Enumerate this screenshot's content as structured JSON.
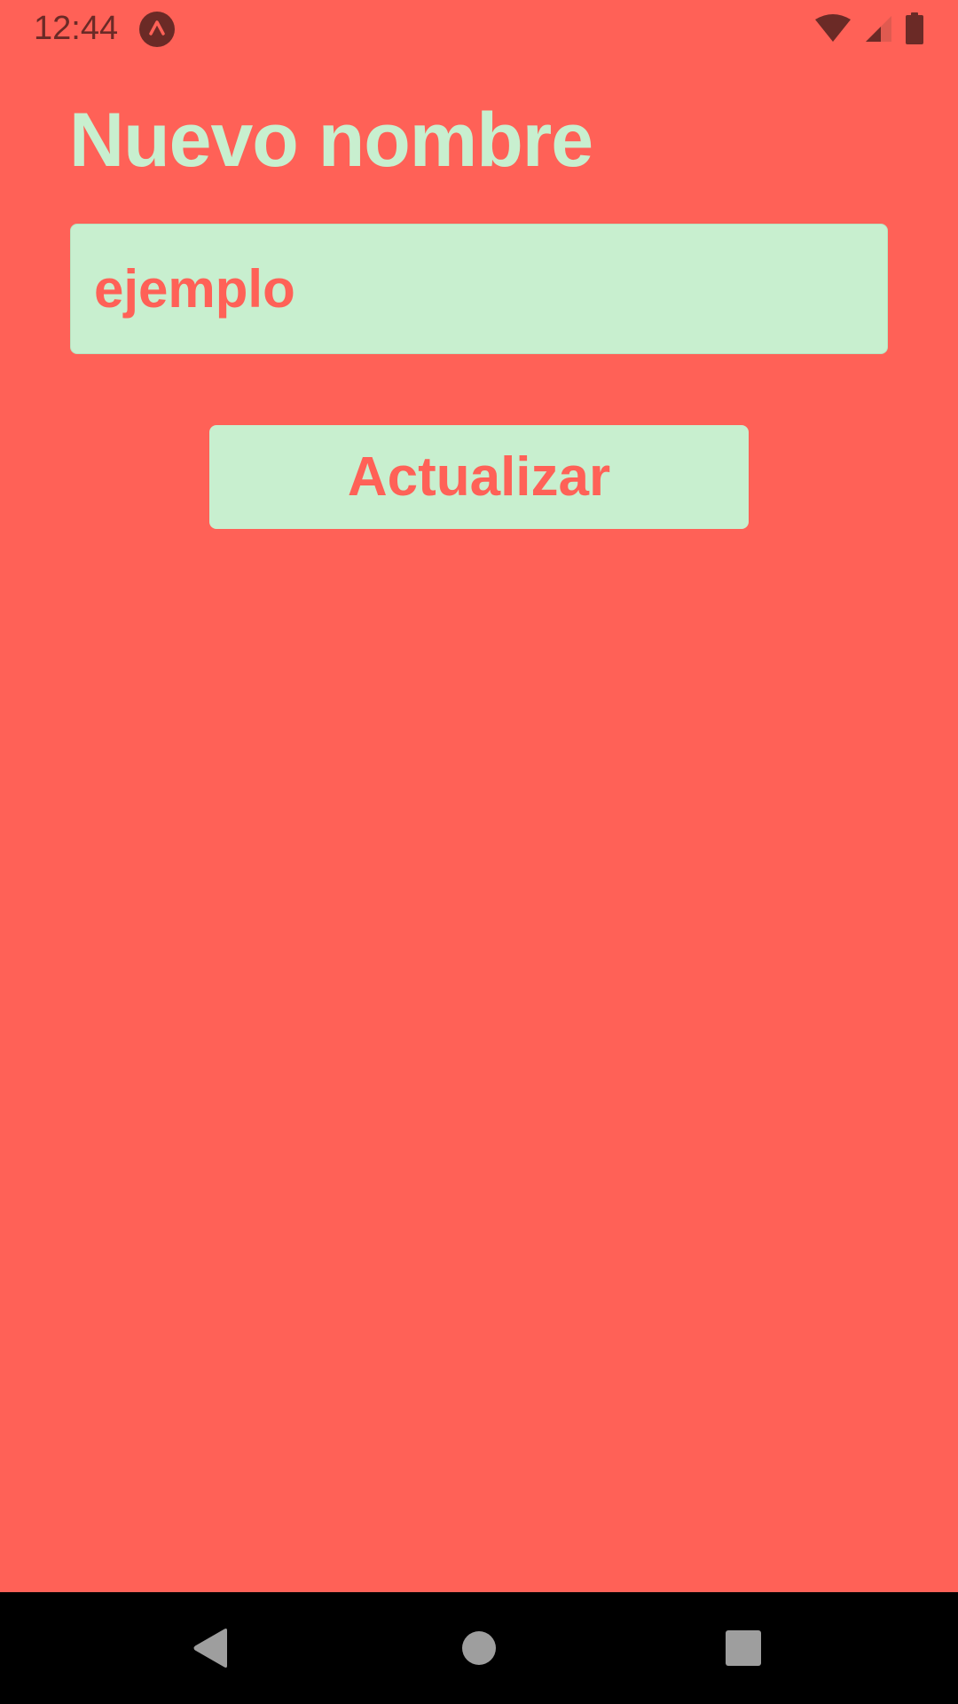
{
  "status_bar": {
    "time": "12:44",
    "icons": [
      "app-notification-icon",
      "wifi-icon",
      "signal-icon",
      "battery-icon"
    ]
  },
  "page": {
    "title": "Nuevo nombre"
  },
  "form": {
    "name_input_value": "ejemplo",
    "update_button_label": "Actualizar"
  },
  "navigation": {
    "icons": [
      "back-icon",
      "home-icon",
      "recents-icon"
    ]
  },
  "colors": {
    "background": "#FF6157",
    "accent_light": "#C8EFCF",
    "status_icons": "#6B2A26",
    "nav_bar": "#000000",
    "nav_icons": "#9E9E9E"
  }
}
